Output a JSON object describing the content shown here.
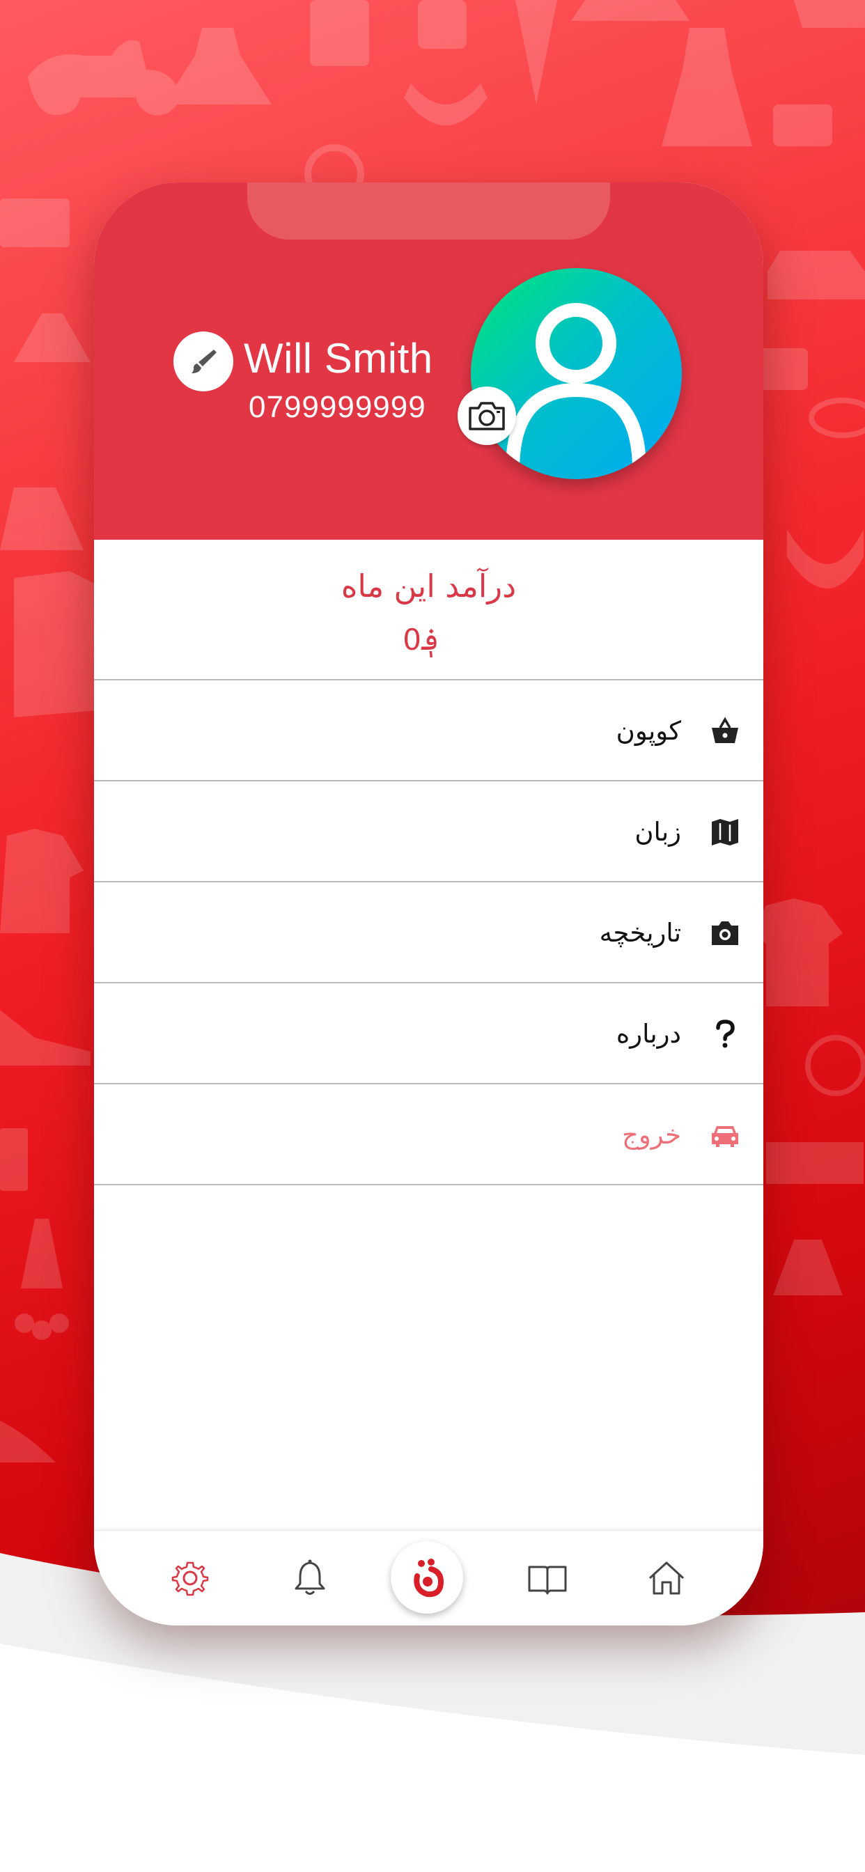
{
  "profile": {
    "name": "Will Smith",
    "phone": "0799999999"
  },
  "earnings": {
    "title": "درآمد این ماه",
    "currency": "؋",
    "value": "0"
  },
  "menu": [
    {
      "label": "کوپون",
      "icon": "basket-icon"
    },
    {
      "label": "زبان",
      "icon": "map-icon"
    },
    {
      "label": "تاریخچه",
      "icon": "camera-icon"
    },
    {
      "label": "درباره",
      "icon": "question-icon"
    },
    {
      "label": "خروج",
      "icon": "car-icon"
    }
  ],
  "bottom_nav": [
    {
      "name": "settings-tab",
      "icon": "gear-icon",
      "active": true
    },
    {
      "name": "notifications-tab",
      "icon": "bell-icon",
      "active": false
    },
    {
      "name": "center-tab",
      "icon": "app-logo-icon",
      "active": false
    },
    {
      "name": "catalog-tab",
      "icon": "book-icon",
      "active": false
    },
    {
      "name": "home-tab",
      "icon": "home-icon",
      "active": false
    }
  ],
  "colors": {
    "header": "#e23645",
    "accent": "#d93847",
    "logout": "#ee6f78",
    "inactive_icon": "#444444"
  }
}
